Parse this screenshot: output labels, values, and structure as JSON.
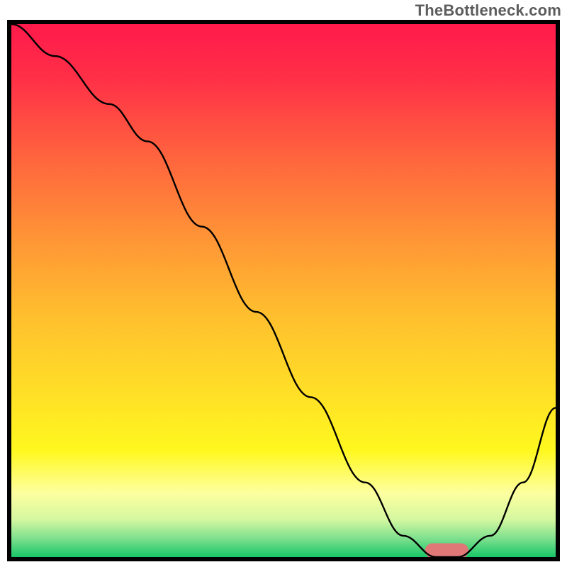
{
  "watermark": "TheBottleneck.com",
  "chart_data": {
    "type": "line",
    "title": "",
    "xlabel": "",
    "ylabel": "",
    "xlim": [
      0,
      100
    ],
    "ylim": [
      0,
      100
    ],
    "series": [
      {
        "name": "bottleneck-curve",
        "x": [
          0,
          8,
          18,
          25,
          35,
          45,
          55,
          65,
          72,
          78,
          82,
          88,
          94,
          100
        ],
        "y": [
          100,
          94,
          85,
          78,
          62,
          46,
          30,
          14,
          4,
          0,
          0,
          4,
          14,
          28
        ],
        "color": "#000000",
        "stroke_width": 2.4
      }
    ],
    "marker": {
      "name": "optimal-range",
      "x_start": 76,
      "x_end": 84,
      "y": 1.2,
      "color": "#e17878",
      "height": 2.8,
      "radius": 1.4
    },
    "background_gradient": {
      "stops": [
        {
          "offset": 0.0,
          "color": "#ff1a4b"
        },
        {
          "offset": 0.1,
          "color": "#ff2f47"
        },
        {
          "offset": 0.25,
          "color": "#ff643e"
        },
        {
          "offset": 0.4,
          "color": "#ff9436"
        },
        {
          "offset": 0.55,
          "color": "#ffc02e"
        },
        {
          "offset": 0.7,
          "color": "#ffe126"
        },
        {
          "offset": 0.8,
          "color": "#fff81f"
        },
        {
          "offset": 0.88,
          "color": "#fdffa0"
        },
        {
          "offset": 0.93,
          "color": "#d4f7a0"
        },
        {
          "offset": 0.965,
          "color": "#7ee08e"
        },
        {
          "offset": 1.0,
          "color": "#18c568"
        }
      ]
    }
  }
}
